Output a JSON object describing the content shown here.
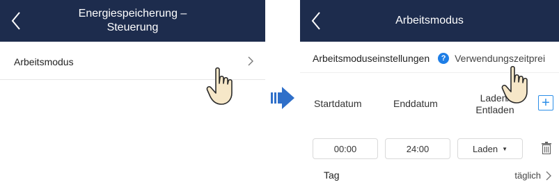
{
  "left_screen": {
    "title_line1": "Energiespeicherung –",
    "title_line2": "Steuerung",
    "menu_item": {
      "label": "Arbeitsmodus",
      "icon": "chevron-right-icon"
    }
  },
  "transition_arrow": {
    "icon": "arrow-right-icon",
    "color": "#2f6fc9"
  },
  "right_screen": {
    "title": "Arbeitsmodus",
    "settings_label": "Arbeitsmoduseinstellungen",
    "help_icon_text": "?",
    "mode_value": "Verwendungszeitprei",
    "columns": {
      "start": "Startdatum",
      "end": "Enddatum",
      "charge_line1": "Laden/",
      "charge_line2": "Entladen"
    },
    "add_button": "+",
    "entry": {
      "start": "00:00",
      "end": "24:00",
      "mode": "Laden"
    },
    "day_label": "Tag",
    "day_value": "täglich"
  },
  "colors": {
    "title_bar": "#1d2c4d",
    "accent": "#1e7ee6",
    "divider": "#e6e6e6"
  }
}
